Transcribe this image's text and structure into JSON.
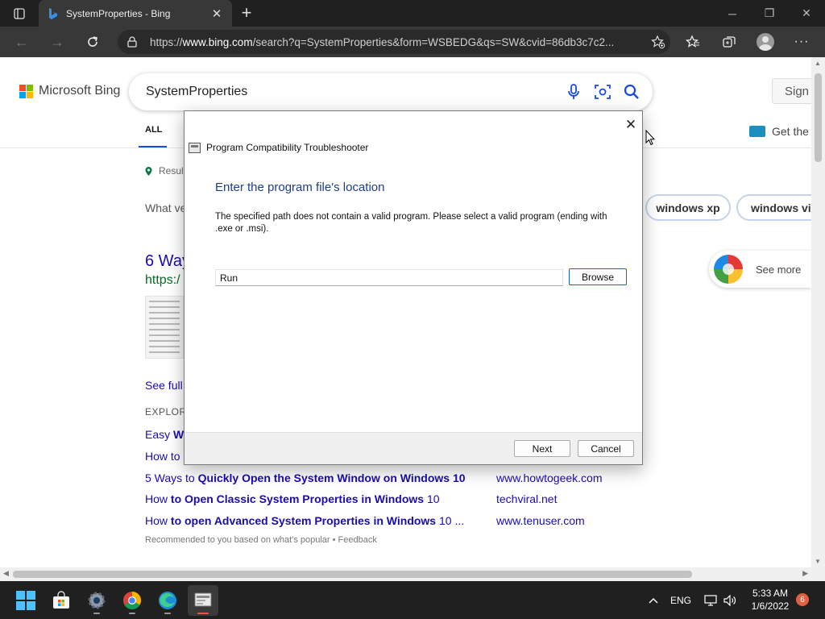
{
  "browser": {
    "tab_title": "SystemProperties - Bing",
    "url_prefix": "https://",
    "url_host": "www.bing.com",
    "url_path": "/search?q=SystemProperties&form=WSBEDG&qs=SW&cvid=86db3c7c2..."
  },
  "bing": {
    "brand": "Microsoft Bing",
    "brand_colors": [
      "#f25022",
      "#7fba00",
      "#00a4ef",
      "#ffb900"
    ],
    "query": "SystemProperties",
    "sign_in": "Sign i",
    "nav_all": "ALL",
    "get_the": "Get the",
    "results_location": "Result",
    "what_version": "What ve",
    "pills": [
      "windows xp",
      "windows vis"
    ],
    "result_title": "6 Way",
    "result_url": "https:/",
    "see_full": "See full",
    "explore": "EXPLOR",
    "explore_links": [
      {
        "pre": "Easy ",
        "bold": "Wa",
        "post": "",
        "site": ""
      },
      {
        "pre": "How to",
        "bold": "",
        "post": "",
        "site": ""
      },
      {
        "pre": "5 Ways to ",
        "bold": "Quickly Open the System Window on Windows 10",
        "post": "",
        "site": "www.howtogeek.com"
      },
      {
        "pre": "How ",
        "bold": "to Open Classic System Properties in Windows",
        "post": " 10",
        "site": "techviral.net"
      },
      {
        "pre": "How ",
        "bold": "to open Advanced System Properties in Windows",
        "post": " 10 ...",
        "site": "www.tenuser.com"
      }
    ],
    "recommended": "Recommended to you based on what's popular • Feedback",
    "see_more": "See more"
  },
  "dialog": {
    "window_title": "Program Compatibility Troubleshooter",
    "heading": "Enter the program file's location",
    "message": "The specified path does not contain a valid program.  Please select a valid program (ending with .exe or .msi).",
    "path_value": "Run",
    "browse_label": "Browse",
    "next_label": "Next",
    "cancel_label": "Cancel",
    "heading_color": "#1c3d8a"
  },
  "taskbar": {
    "language": "ENG",
    "time": "5:33 AM",
    "date": "1/6/2022",
    "notification_count": "6",
    "apps": [
      "start-icon",
      "store-icon",
      "settings-icon",
      "chrome-icon",
      "edge-icon",
      "troubleshooter-icon"
    ]
  }
}
